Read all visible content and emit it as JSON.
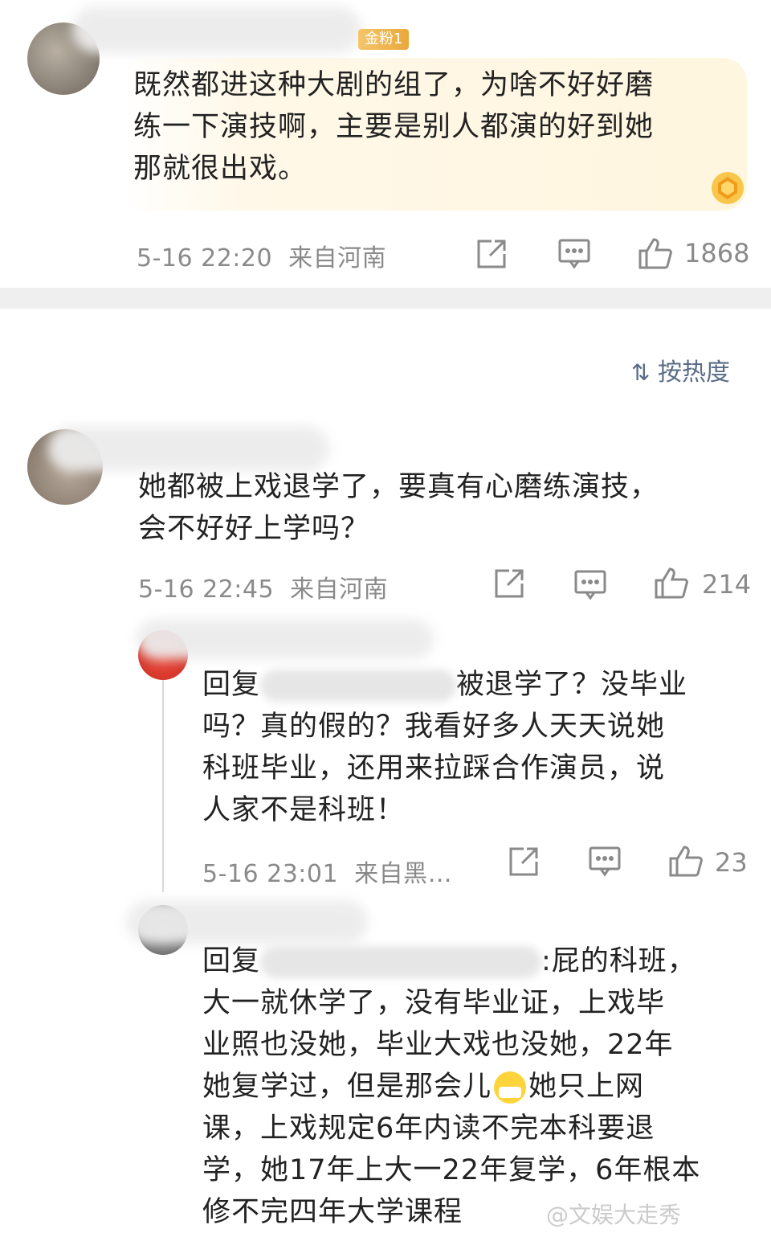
{
  "main_comment": {
    "badge": "金粉1",
    "text_lines": [
      "既然都进这种大剧的组了，为啥不好好磨",
      "练一下演技啊，主要是别人都演的好到她",
      "那就很出戏。"
    ],
    "time": "5-16 22:20",
    "location": "来自河南",
    "likes": "1868"
  },
  "sort": {
    "label": "按热度"
  },
  "comment2": {
    "text_lines": [
      "她都被上戏退学了，要真有心磨练演技，",
      "会不好好上学吗？"
    ],
    "time": "5-16 22:45",
    "location": "来自河南",
    "likes": "214"
  },
  "reply1": {
    "prefix": "回复",
    "after_mention": "被退学了？没毕业",
    "text_lines": [
      "吗？真的假的？我看好多人天天说她",
      "科班毕业，还用来拉踩合作演员，说",
      "人家不是科班！"
    ],
    "time": "5-16 23:01",
    "location": "来自黑…",
    "likes": "23"
  },
  "reply2": {
    "prefix": "回复",
    "after_mention": ":屁的科班，",
    "line2": "大一就休学了，没有毕业证，上戏毕",
    "line3": "业照也没她，毕业大戏也没她，22年",
    "line4a": "她复学过，但是那会儿",
    "line4b": "她只上网",
    "line5": "课，上戏规定6年内读不完本科要退",
    "line6": "学，她17年上大一22年复学，6年根本",
    "line7": "修不完四年大学课程"
  },
  "watermark": "@文娱大走秀"
}
